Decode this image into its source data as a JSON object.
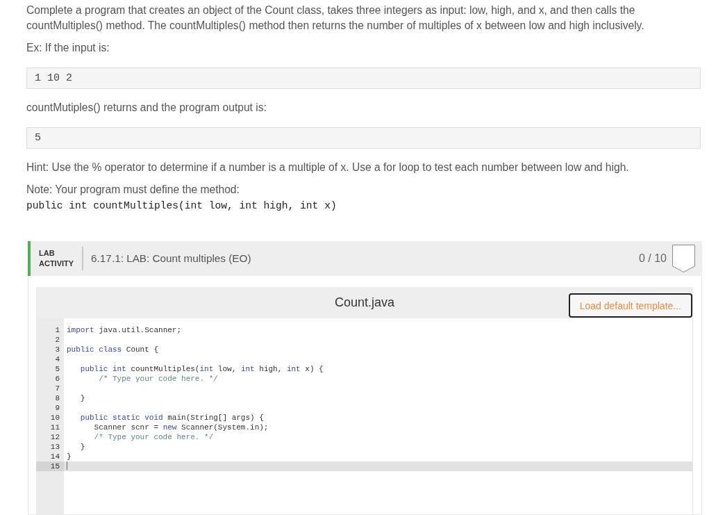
{
  "instructions": [
    {
      "kind": "paragraph",
      "text": "Complete a program that creates an object of the Count class, takes three integers as input: low, high, and x, and then calls the countMultiples() method. The countMultiples() method then returns the number of multiples of x between low and high inclusively."
    },
    {
      "kind": "paragraph",
      "text": "Ex: If the input is:"
    },
    {
      "kind": "code_block",
      "text": "1 10 2"
    },
    {
      "kind": "paragraph",
      "text": "countMutiples() returns and the program output is:"
    },
    {
      "kind": "code_block",
      "text": "5"
    },
    {
      "kind": "paragraph",
      "text": "Hint: Use the % operator to determine if a number is a multiple of x. Use a for loop to test each number between low and high."
    },
    {
      "kind": "paragraph",
      "text": "Note: Your program must define the method:"
    },
    {
      "kind": "signature",
      "text": "public int countMultiples(int low, int high, int x)"
    }
  ],
  "lab_activity": {
    "label": "LAB ACTIVITY",
    "title": "6.17.1: LAB: Count multiples (EO)",
    "score": "0 / 10",
    "completed": false,
    "editor": {
      "file_name": "Count.java",
      "button": "Load default template...",
      "lines": [
        {
          "number": "1",
          "active": false,
          "tokens": [
            {
              "kind": "keyword",
              "text": "import"
            },
            {
              "kind": "text",
              "text": " java.util.Scanner;"
            }
          ]
        },
        {
          "number": "2",
          "active": false
        },
        {
          "number": "3",
          "active": false,
          "tokens": [
            {
              "kind": "keyword",
              "text": "public class"
            },
            {
              "kind": "text",
              "text": " Count {"
            }
          ]
        },
        {
          "number": "4",
          "active": false
        },
        {
          "number": "5",
          "active": false,
          "tokens": [
            {
              "kind": "keyword",
              "text": "   public int"
            },
            {
              "kind": "text",
              "text": " countMultiples("
            },
            {
              "kind": "keyword",
              "text": "int"
            },
            {
              "kind": "text",
              "text": " low, "
            },
            {
              "kind": "keyword",
              "text": "int"
            },
            {
              "kind": "text",
              "text": " high, "
            },
            {
              "kind": "keyword",
              "text": "int"
            },
            {
              "kind": "text",
              "text": " x) {"
            }
          ]
        },
        {
          "number": "6",
          "active": false,
          "tokens": [
            {
              "kind": "comment",
              "text": "       /* Type your code here. */"
            }
          ]
        },
        {
          "number": "7",
          "active": false
        },
        {
          "number": "8",
          "active": false,
          "tokens": [
            {
              "kind": "text",
              "text": "   }"
            }
          ]
        },
        {
          "number": "9",
          "active": false
        },
        {
          "number": "10",
          "active": false,
          "tokens": [
            {
              "kind": "keyword",
              "text": "   public static void"
            },
            {
              "kind": "text",
              "text": " main(String[] args) {"
            }
          ]
        },
        {
          "number": "11",
          "active": false,
          "tokens": [
            {
              "kind": "text",
              "text": "      Scanner scnr = "
            },
            {
              "kind": "keyword",
              "text": "new"
            },
            {
              "kind": "text",
              "text": " Scanner(System.in);"
            }
          ]
        },
        {
          "number": "12",
          "active": false,
          "tokens": [
            {
              "kind": "comment",
              "text": "      /* Type your code here. */"
            }
          ]
        },
        {
          "number": "13",
          "active": false,
          "tokens": [
            {
              "kind": "text",
              "text": "   }"
            }
          ]
        },
        {
          "number": "14",
          "active": false,
          "tokens": [
            {
              "kind": "text",
              "text": "}"
            }
          ]
        },
        {
          "number": "15",
          "active": true
        }
      ]
    }
  }
}
